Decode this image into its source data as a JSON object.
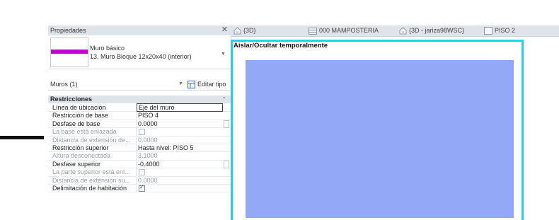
{
  "panel": {
    "title": "Propiedades",
    "type_family": "Muro básico",
    "type_name": "13. Muro Bloque 12x20x40 (interior)",
    "instances_label": "Muros (1)",
    "edit_type_label": "Editar tipo",
    "section_title": "Restricciones"
  },
  "properties": [
    {
      "name": "Línea de ubicación",
      "value": "Eje del muro",
      "state": "editing"
    },
    {
      "name": "Restricción de base",
      "value": "PISO 4",
      "state": "normal"
    },
    {
      "name": "Desfase de base",
      "value": "0.0000",
      "state": "normal"
    },
    {
      "name": "La base está enlazada",
      "value": "",
      "state": "disabled",
      "checkbox": false
    },
    {
      "name": "Distancia de extensión de...",
      "value": "0.0000",
      "state": "disabled"
    },
    {
      "name": "Restricción superior",
      "value": "Hasta nivel: PISO 5",
      "state": "normal"
    },
    {
      "name": "Altura desconectada",
      "value": "3.1000",
      "state": "disabled"
    },
    {
      "name": "Desfase superior",
      "value": "-0.4000",
      "state": "normal"
    },
    {
      "name": "La parte superior está enl...",
      "value": "",
      "state": "disabled",
      "checkbox": false
    },
    {
      "name": "Distancia de extensión su...",
      "value": "0.0000",
      "state": "disabled"
    },
    {
      "name": "Delimitación de habitación",
      "value": "",
      "state": "normal",
      "checkbox": true
    }
  ],
  "tabs": [
    {
      "label": "{3D}",
      "icon": "house-3d-icon"
    },
    {
      "label": "000 MAMPOSTERIA",
      "icon": "floor-plan-icon"
    },
    {
      "label": "{3D - jariza98WSC}",
      "icon": "house-3d-icon"
    },
    {
      "label": "PISO 2",
      "icon": "sheet-icon"
    }
  ],
  "viewport": {
    "banner": "Aislar/Ocultar temporalmente"
  },
  "colors": {
    "highlight_border": "#18d6ee",
    "wall_fill": "#93a9f7",
    "wall_swatch": "#c300d8",
    "panel_header": "#dfe4ea"
  }
}
